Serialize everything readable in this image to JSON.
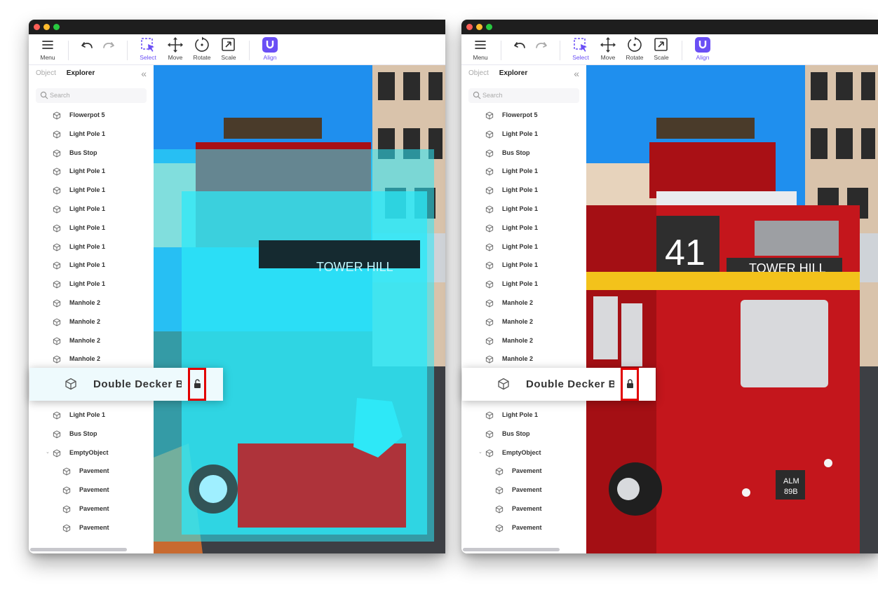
{
  "toolbar": {
    "menu": "Menu",
    "select": "Select",
    "move": "Move",
    "rotate": "Rotate",
    "scale": "Scale",
    "align": "Align"
  },
  "panel": {
    "tabs": [
      "Object",
      "Explorer"
    ],
    "search_placeholder": "Search"
  },
  "items": [
    {
      "name": "Flowerpot 5"
    },
    {
      "name": "Light Pole 1"
    },
    {
      "name": "Bus Stop"
    },
    {
      "name": "Light Pole 1"
    },
    {
      "name": "Light Pole 1"
    },
    {
      "name": "Light Pole 1"
    },
    {
      "name": "Light Pole 1"
    },
    {
      "name": "Light Pole 1"
    },
    {
      "name": "Light Pole 1"
    },
    {
      "name": "Light Pole 1"
    },
    {
      "name": "Manhole 2"
    },
    {
      "name": "Manhole 2"
    },
    {
      "name": "Manhole 2"
    },
    {
      "name": "Manhole 2"
    },
    {
      "name": "Double Decker Bus"
    },
    {
      "name": "Light Pole 1"
    },
    {
      "name": "Bus Stop"
    },
    {
      "name": "EmptyObject",
      "expanded": true
    },
    {
      "name": "Pavement",
      "level": 2
    },
    {
      "name": "Pavement",
      "level": 2
    },
    {
      "name": "Pavement",
      "level": 2
    },
    {
      "name": "Pavement",
      "level": 2
    }
  ],
  "dragged_item": {
    "name": "Double Decker Bus",
    "left_lock_state": "unlocked",
    "right_lock_state": "locked"
  },
  "scene": {
    "route_number": "41",
    "destination": "TOWER HILL",
    "plate_line1": "ALM",
    "plate_line2": "89B"
  },
  "colors": {
    "accent": "#6a4ff5",
    "sky": "#1f8fee",
    "bus_red": "#c4161c",
    "ghost_cyan": "#2ee8f7",
    "highlight_box": "#e10000"
  }
}
